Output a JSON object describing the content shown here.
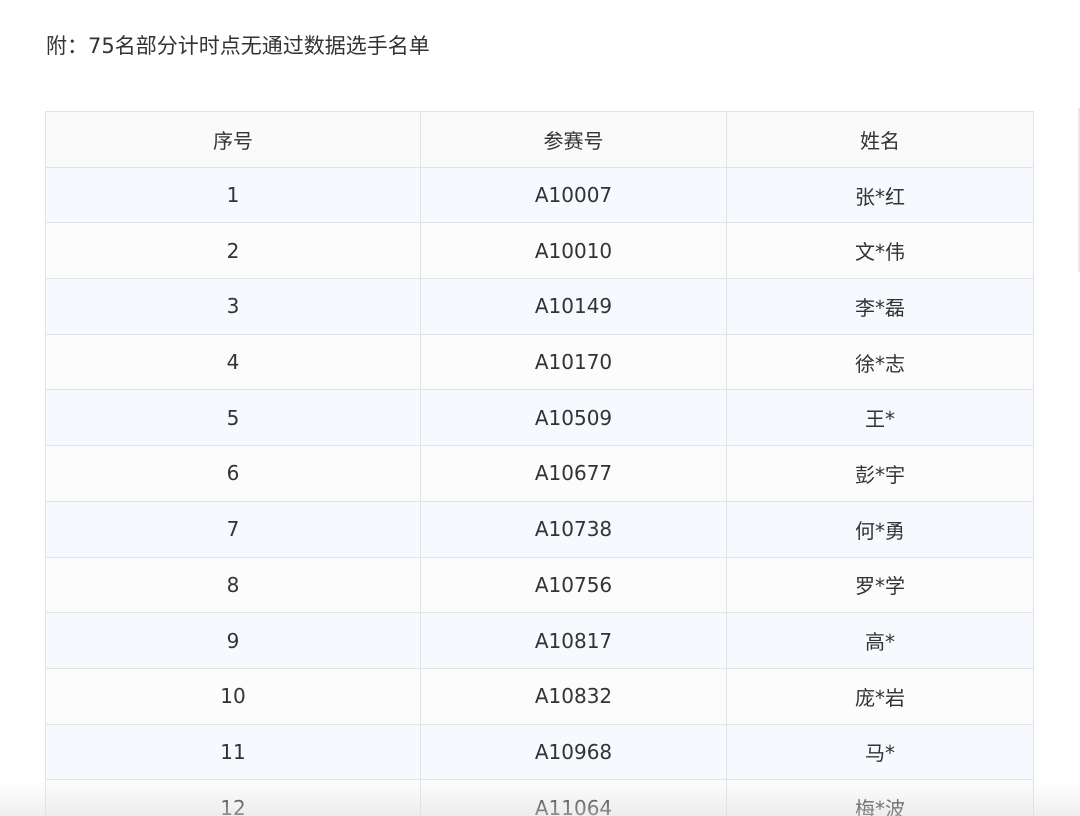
{
  "caption": "附：75名部分计时点无通过数据选手名单",
  "table": {
    "headers": [
      "序号",
      "参赛号",
      "姓名"
    ],
    "rows": [
      [
        "1",
        "A10007",
        "张*红"
      ],
      [
        "2",
        "A10010",
        "文*伟"
      ],
      [
        "3",
        "A10149",
        "李*磊"
      ],
      [
        "4",
        "A10170",
        "徐*志"
      ],
      [
        "5",
        "A10509",
        "王*"
      ],
      [
        "6",
        "A10677",
        "彭*宇"
      ],
      [
        "7",
        "A10738",
        "何*勇"
      ],
      [
        "8",
        "A10756",
        "罗*学"
      ],
      [
        "9",
        "A10817",
        "高*"
      ],
      [
        "10",
        "A10832",
        "庞*岩"
      ],
      [
        "11",
        "A10968",
        "马*"
      ],
      [
        "12",
        "A11064",
        "梅*波"
      ]
    ]
  }
}
